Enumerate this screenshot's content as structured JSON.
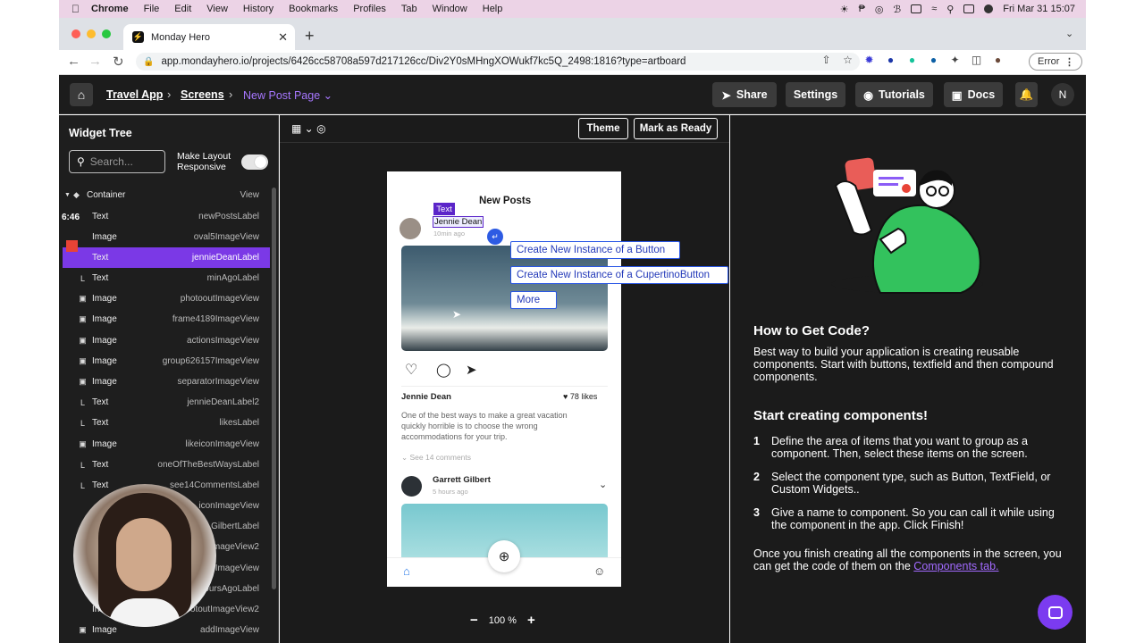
{
  "menubar": {
    "apple": "",
    "items": [
      "Chrome",
      "File",
      "Edit",
      "View",
      "History",
      "Bookmarks",
      "Profiles",
      "Tab",
      "Window",
      "Help"
    ],
    "clock": "Fri Mar 31  15:07"
  },
  "browser": {
    "tab_title": "Monday Hero",
    "url": "app.mondayhero.io/projects/6426cc58708a597d217126cc/Div2Y0sMHngXOWukf7kc5Q_2498:1816?type=artboard",
    "error_label": "Error"
  },
  "header": {
    "breadcrumb": [
      "Travel App",
      "Screens"
    ],
    "current_page": "New Post Page",
    "buttons": {
      "share": "Share",
      "settings": "Settings",
      "tutorials": "Tutorials",
      "docs": "Docs"
    },
    "avatar_initial": "N"
  },
  "left": {
    "title": "Widget Tree",
    "search_placeholder": "Search...",
    "layout_label_1": "Make Layout",
    "layout_label_2": "Responsive",
    "timestamp": "6:46",
    "rows": [
      {
        "type": "Container",
        "name": "View",
        "icon": "layers-icon"
      },
      {
        "type": "Text",
        "name": "newPostsLabel",
        "icon": ""
      },
      {
        "type": "Image",
        "name": "oval5ImageView",
        "icon": ""
      },
      {
        "type": "Text",
        "name": "jennieDeanLabel",
        "icon": ""
      },
      {
        "type": "Text",
        "name": "minAgoLabel",
        "icon": "text-icon"
      },
      {
        "type": "Image",
        "name": "photooutImageView",
        "icon": "image-icon"
      },
      {
        "type": "Image",
        "name": "frame4189ImageView",
        "icon": "image-icon"
      },
      {
        "type": "Image",
        "name": "actionsImageView",
        "icon": "image-icon"
      },
      {
        "type": "Image",
        "name": "group626157ImageView",
        "icon": "image-icon"
      },
      {
        "type": "Image",
        "name": "separatorImageView",
        "icon": "image-icon"
      },
      {
        "type": "Text",
        "name": "jennieDeanLabel2",
        "icon": "text-icon"
      },
      {
        "type": "Text",
        "name": "likesLabel",
        "icon": "text-icon"
      },
      {
        "type": "Image",
        "name": "likeiconImageView",
        "icon": "image-icon"
      },
      {
        "type": "Text",
        "name": "oneOfTheBestWaysLabel",
        "icon": "text-icon"
      },
      {
        "type": "Text",
        "name": "see14CommentsLabel",
        "icon": "text-icon"
      },
      {
        "type": "",
        "name": "iconImageView",
        "icon": ""
      },
      {
        "type": "",
        "name": "GilbertLabel",
        "icon": ""
      },
      {
        "type": "",
        "name": "ImageView2",
        "icon": ""
      },
      {
        "type": "",
        "name": "ImageView",
        "icon": ""
      },
      {
        "type": "",
        "name": "oursAgoLabel",
        "icon": ""
      },
      {
        "type": "In",
        "name": "otoutImageView2",
        "icon": ""
      },
      {
        "type": "Image",
        "name": "addImageView",
        "icon": "image-icon"
      }
    ]
  },
  "canvas": {
    "theme_btn": "Theme",
    "ready_btn": "Mark as Ready",
    "zoom": "100 %",
    "phone": {
      "title": "New Posts",
      "text_tag": "Text",
      "author": "Jennie Dean",
      "time": "10min ago",
      "author2": "Jennie Dean",
      "likes": "78 likes",
      "body": "One of the best ways to make a great vacation quickly horrible is to choose the wrong accommodations for your trip.",
      "comments": "See 14 comments",
      "commenter": "Garrett Gilbert",
      "commenter_time": "5 hours ago"
    },
    "context_menu": [
      "Create New Instance of a Button",
      "Create New Instance of a CupertinoButton",
      "More"
    ]
  },
  "right": {
    "h1": "How to Get Code?",
    "intro": "Best way to build your application is creating reusable components. Start with buttons, textfield and then compound components.",
    "h2": "Start creating components!",
    "steps": [
      {
        "n": "1",
        "text": "Define the area of items that you want to group as a component. Then, select these items on the screen."
      },
      {
        "n": "2",
        "text": "Select the component type, such as Button, TextField, or Custom Widgets.."
      },
      {
        "n": "3",
        "text": "Give a name to component. So you can call it while using the component in the app. Click Finish!"
      }
    ],
    "outro": "Once you finish creating all the components in the screen, you can get the code of them on the ",
    "outro_link": "Components tab."
  }
}
